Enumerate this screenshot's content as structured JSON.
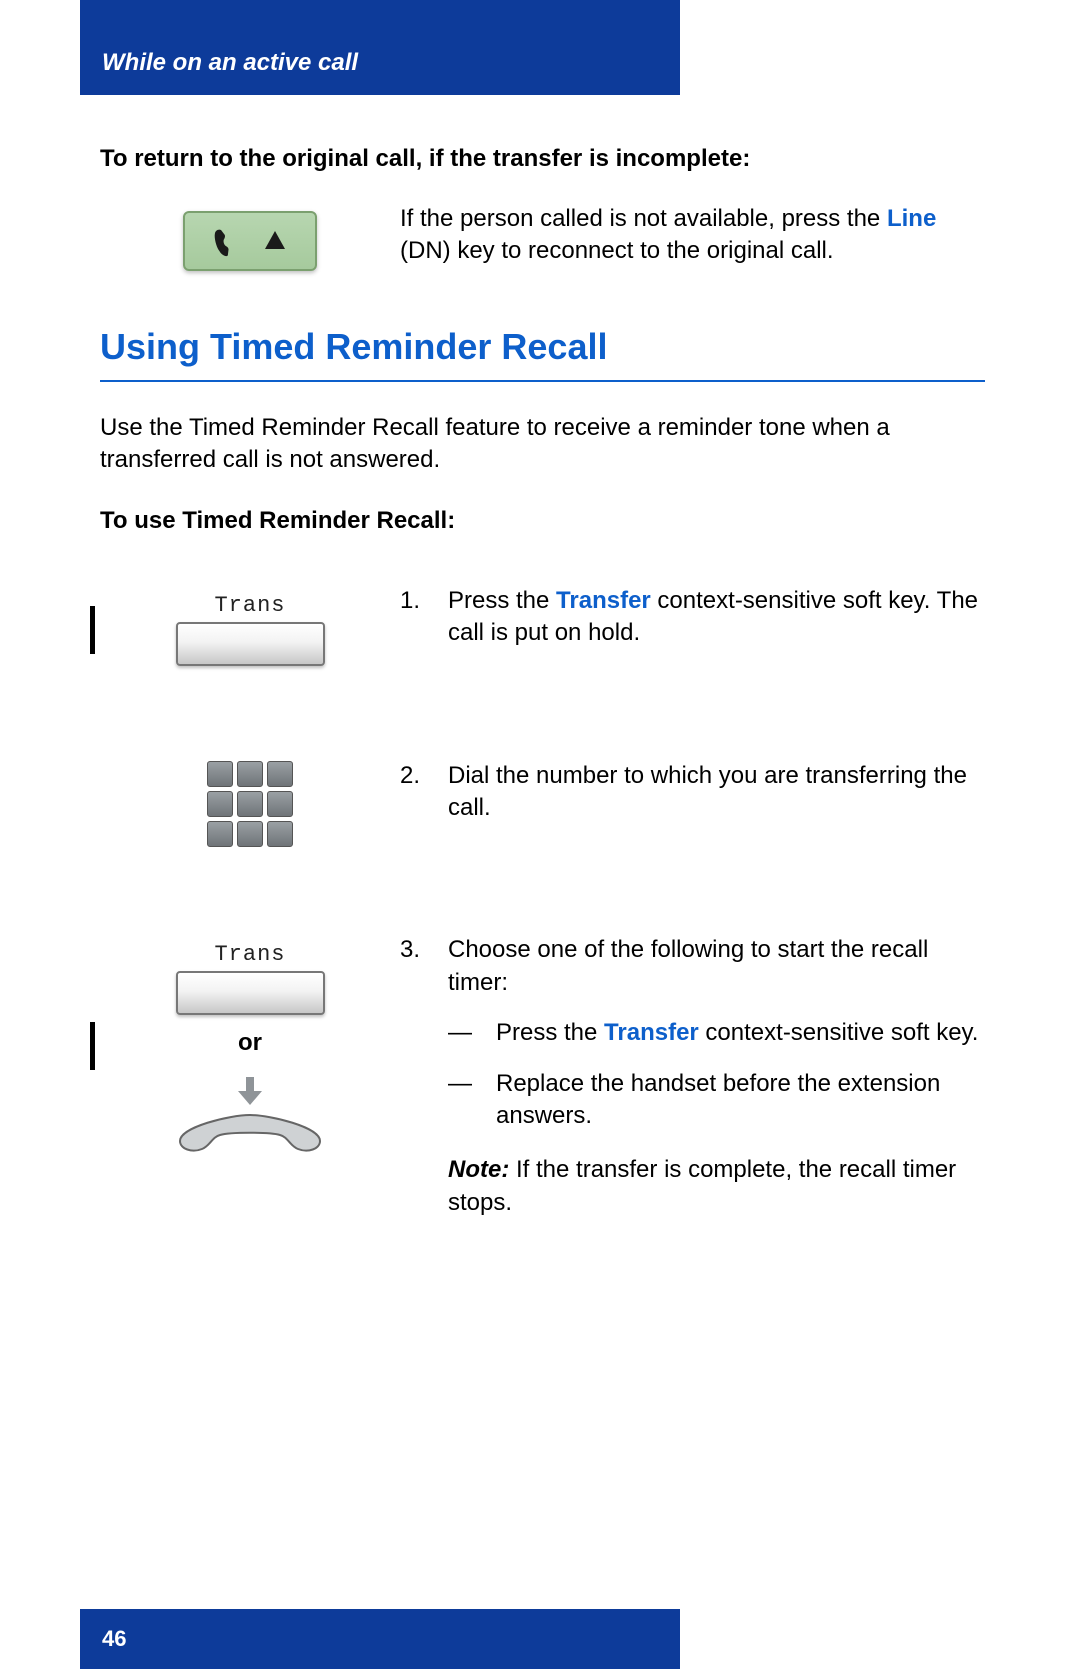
{
  "header": {
    "chapter": "While on an active call"
  },
  "intro": {
    "instruction": "To return to the original call, if the transfer is incomplete:",
    "line_text_pre": "If the person called is not available, press the ",
    "line_link": "Line",
    "line_text_post": " (DN) key to reconnect to the original call."
  },
  "section": {
    "title": "Using Timed Reminder Recall",
    "body": "Use the Timed Reminder Recall feature to receive a reminder tone when a transferred call is not answered.",
    "sub_instruction": "To use Timed Reminder Recall:"
  },
  "softkey": {
    "label": "Trans"
  },
  "or_label": "or",
  "steps": {
    "s1": {
      "num": "1.",
      "pre": "Press the ",
      "link": "Transfer",
      "post": " context-sensitive soft key. The call is put on hold."
    },
    "s2": {
      "num": "2.",
      "text": "Dial the number to which you are transferring the call."
    },
    "s3": {
      "num": "3.",
      "intro": "Choose one of the following to start the recall timer:",
      "opt1_pre": "Press the ",
      "opt1_link": "Transfer",
      "opt1_post": " context-sensitive soft key.",
      "opt2": "Replace the handset before the extension answers.",
      "note_label": "Note:",
      "note_text": " If the transfer is complete, the recall timer stops."
    }
  },
  "footer": {
    "page": "46"
  }
}
